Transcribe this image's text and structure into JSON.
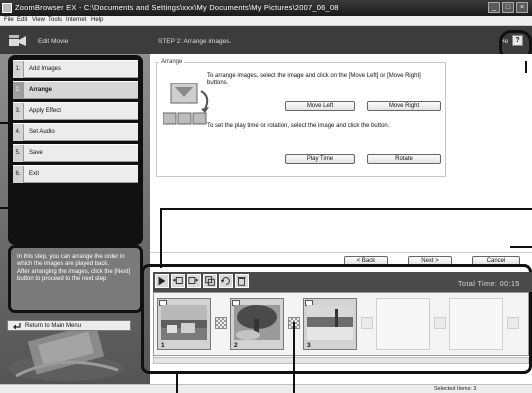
{
  "window": {
    "title": "ZoomBrowser EX  -  C:\\Documents and Settings\\xxx\\My Documents\\My Pictures\\2007_06_08",
    "minimize_label": "_",
    "maximize_label": "□",
    "close_label": "×"
  },
  "menu": [
    "File",
    "Edit",
    "View",
    "Tools",
    "Internet",
    "Help"
  ],
  "left_header": {
    "label": "Edit Movie"
  },
  "step_header": {
    "label": "STEP 2: Arrange images.",
    "help_text": "He",
    "help_button": "?"
  },
  "steps": [
    {
      "num": "1.",
      "label": "Add Images",
      "active": false
    },
    {
      "num": "2.",
      "label": "Arrange",
      "active": true
    },
    {
      "num": "3.",
      "label": "Apply Effect",
      "active": false
    },
    {
      "num": "4.",
      "label": "Set Audio",
      "active": false
    },
    {
      "num": "5.",
      "label": "Save",
      "active": false
    },
    {
      "num": "6.",
      "label": "Exit",
      "active": false
    }
  ],
  "info_text": "In this step, you can arrange the order in which the images are played back.\nAfter arranging the images, click the [Next] button to proceed to the next step",
  "return_button": "Return to Main Menu",
  "arrange": {
    "legend": "Arrange",
    "instruction1": "To arrange images, select the image and click on the [Move Left] or [Move Right] buttons.",
    "move_left": "Move Left",
    "move_right": "Move Right",
    "instruction2": "To set the play time or rotation, select the image and click the button.",
    "play_time": "Play Time",
    "rotate": "Rotate"
  },
  "nav": {
    "back": "< Back",
    "next": "Next >",
    "cancel": "Cancel"
  },
  "storyboard": {
    "total_time": "Total Time: 00:15",
    "thumbnails": [
      {
        "number": "1",
        "subject": "coastal-town-photo",
        "empty": false
      },
      {
        "number": "2",
        "subject": "tree-rock-photo",
        "empty": false
      },
      {
        "number": "3",
        "subject": "beach-photo",
        "empty": false
      },
      {
        "number": "",
        "subject": "empty",
        "empty": true
      },
      {
        "number": "",
        "subject": "empty",
        "empty": true
      },
      {
        "number": "",
        "subject": "empty",
        "empty": true
      }
    ]
  },
  "status": {
    "text": "Selected Items: 3"
  }
}
